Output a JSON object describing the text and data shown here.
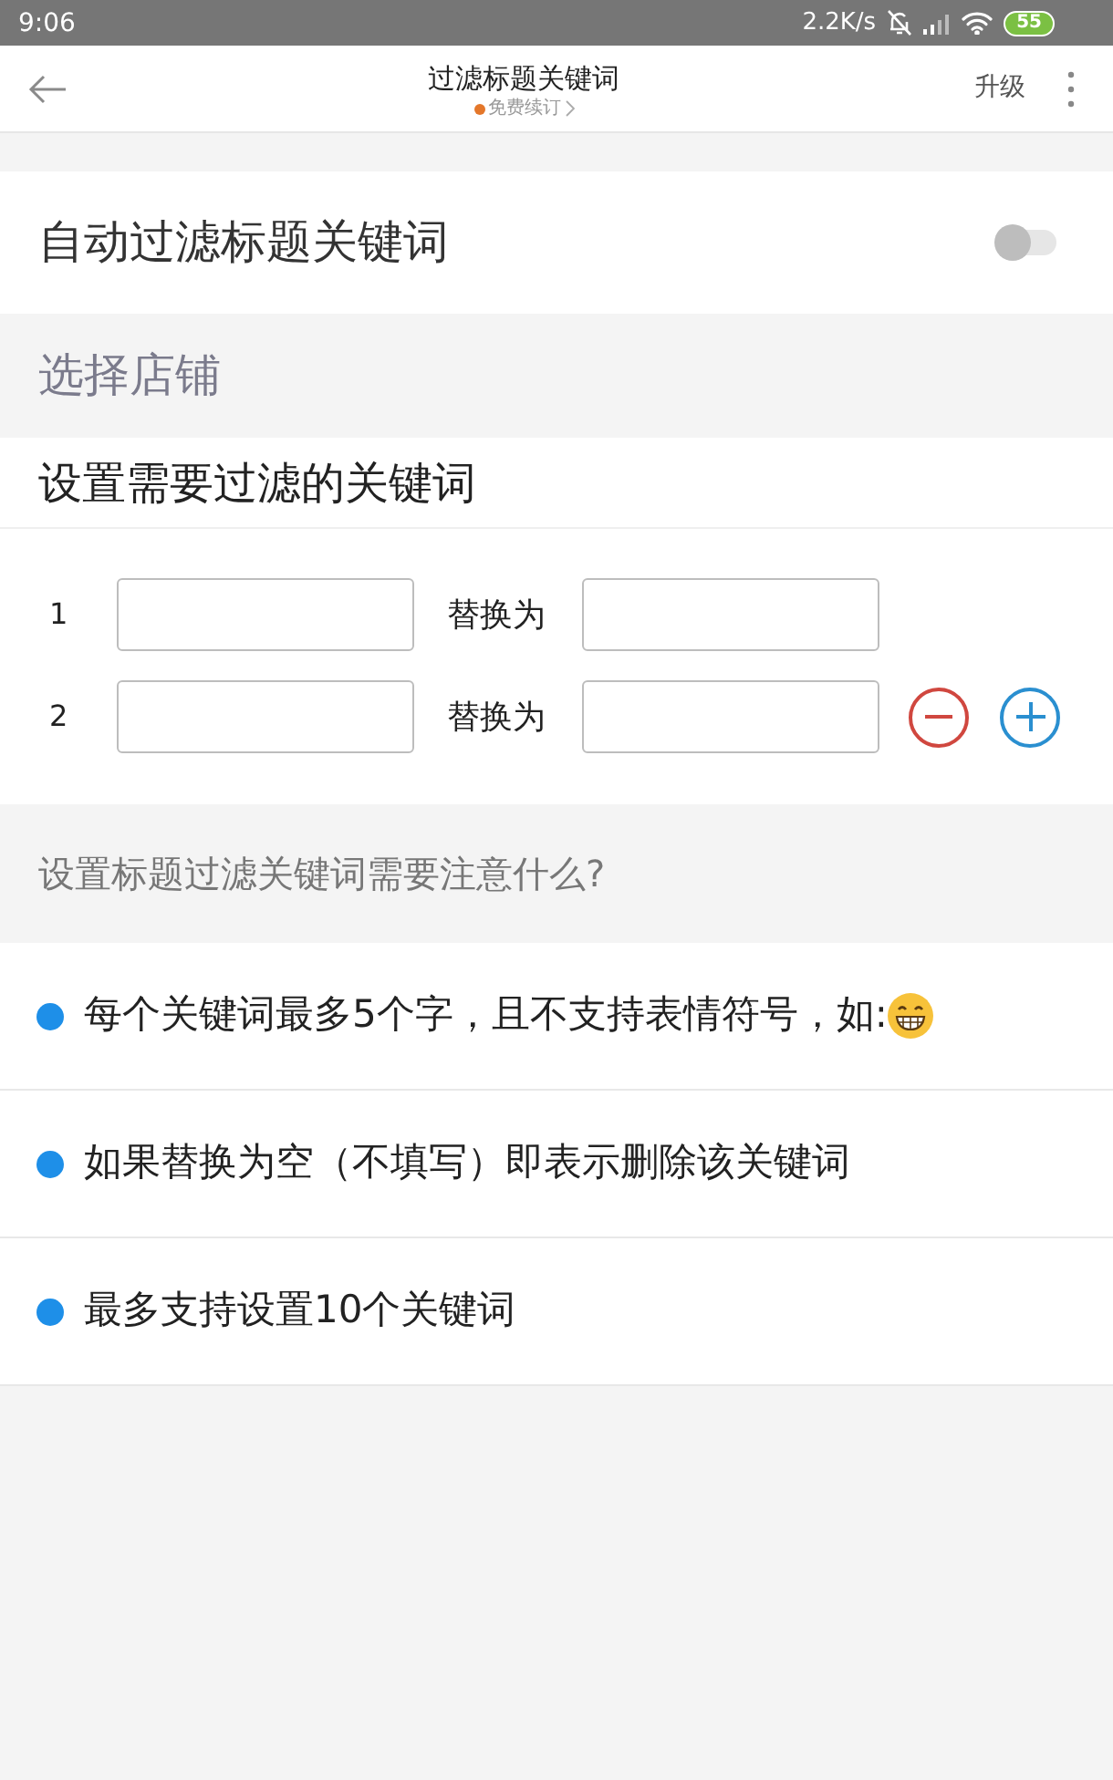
{
  "status_bar": {
    "time": "9:06",
    "net_speed": "2.2K/s",
    "battery": "55"
  },
  "header": {
    "title": "过滤标题关键词",
    "subtitle": "免费续订",
    "action": "升级"
  },
  "auto_filter": {
    "label": "自动过滤标题关键词",
    "on": false
  },
  "store_select": {
    "label": "选择店铺"
  },
  "keywords": {
    "title": "设置需要过滤的关键词",
    "rows": [
      {
        "index": "1",
        "replace_label": "替换为"
      },
      {
        "index": "2",
        "replace_label": "替换为",
        "actions": [
          {
            "kind": "remove"
          },
          {
            "kind": "add"
          }
        ]
      }
    ]
  },
  "tips": {
    "question": "设置标题过滤关键词需要注意什么?",
    "items": [
      {
        "kind": "emoji",
        "text": "每个关键词最多5个字，且不支持表情符号，如:"
      },
      {
        "kind": "plain",
        "text": "如果替换为空（不填写）即表示删除该关键词"
      },
      {
        "kind": "plain",
        "text": "最多支持设置10个关键词"
      }
    ]
  }
}
